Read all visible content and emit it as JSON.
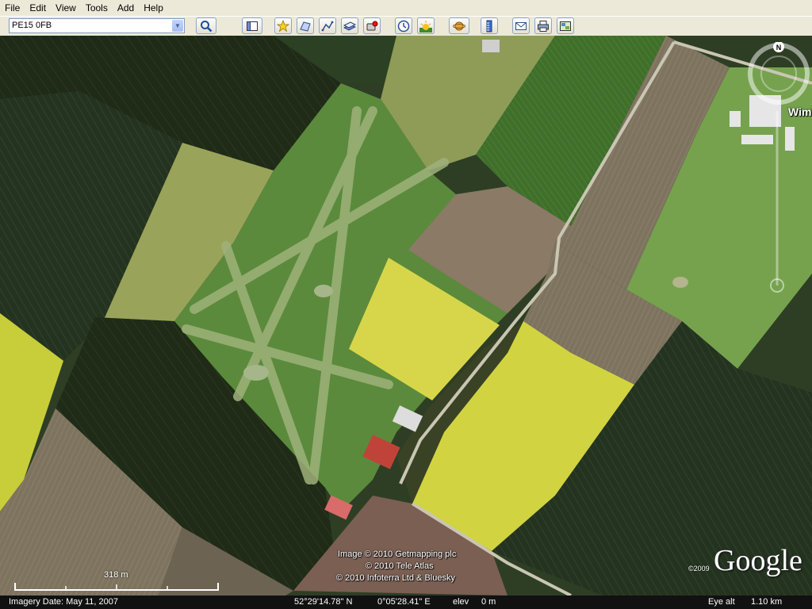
{
  "menu": [
    "File",
    "Edit",
    "View",
    "Tools",
    "Add",
    "Help"
  ],
  "search": {
    "value": "PE15 0FB"
  },
  "toolbar_icons": [
    "search-icon",
    "sidebar-icon",
    "placemark-icon",
    "polygon-icon",
    "path-icon",
    "image-overlay-icon",
    "record-tour-icon",
    "historical-imagery-icon",
    "sunlight-icon",
    "planets-icon",
    "ruler-icon",
    "email-icon",
    "print-icon",
    "view-in-maps-icon"
  ],
  "map": {
    "place_label": "Wimb",
    "compass_north": "N",
    "scale_label": "318 m",
    "copyright_lines": [
      "Image © 2010 Getmapping plc",
      "© 2010 Tele Atlas",
      "© 2010 Infoterra Ltd & Bluesky"
    ],
    "logo_year": "©2009",
    "logo_text": "Google"
  },
  "status": {
    "imagery_date": "Imagery Date: May 11, 2007",
    "lat": "52°29'14.78\" N",
    "lon": "0°05'28.41\" E",
    "elev_label": "elev",
    "elev_value": "0 m",
    "eye_alt_label": "Eye alt",
    "eye_alt_value": "1.10 km"
  }
}
